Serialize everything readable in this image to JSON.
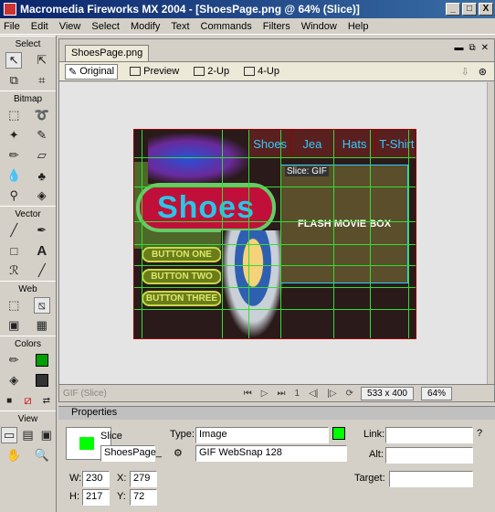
{
  "window": {
    "title": "Macromedia Fireworks MX 2004 - [ShoesPage.png @ 64% (Slice)]",
    "min": "_",
    "max": "□",
    "close": "X"
  },
  "menu": [
    "File",
    "Edit",
    "View",
    "Select",
    "Modify",
    "Text",
    "Commands",
    "Filters",
    "Window",
    "Help"
  ],
  "tools": {
    "select": "Select",
    "bitmap": "Bitmap",
    "vector": "Vector",
    "web": "Web",
    "colors": "Colors",
    "view": "View"
  },
  "document": {
    "tab": "ShoesPage.png",
    "views": [
      "Original",
      "Preview",
      "2-Up",
      "4-Up"
    ],
    "status_left": "GIF (Slice)",
    "frame": "1",
    "size": "533 x 400",
    "zoom": "64%"
  },
  "art": {
    "nav": [
      "Shoes",
      "Jea",
      "Hats",
      "T-Shirt"
    ],
    "logo": "Shoes",
    "buttons": [
      "BUTTON ONE",
      "BUTTON TWO",
      "BUTTON THREE"
    ],
    "flash": "FLASH MOVIE BOX",
    "slice_label": "Slice: GIF"
  },
  "properties": {
    "title": "Properties",
    "kind": "Slice",
    "name": "ShoesPage_",
    "type_label": "Type:",
    "type_value": "Image",
    "format": "GIF WebSnap 128",
    "link_label": "Link:",
    "alt_label": "Alt:",
    "target_label": "Target:",
    "w_label": "W:",
    "w": "230",
    "h_label": "H:",
    "h": "217",
    "x_label": "X:",
    "x": "279",
    "y_label": "Y:",
    "y": "72"
  },
  "colors": {
    "slice_green": "#00ff00",
    "titlebar": "#0a246a"
  }
}
